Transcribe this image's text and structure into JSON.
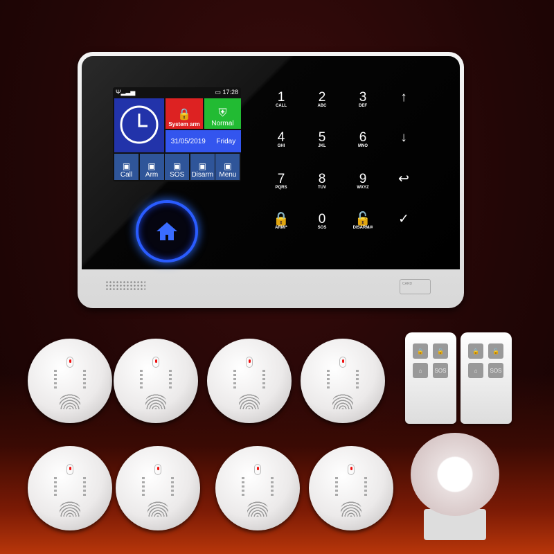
{
  "lcd": {
    "time": "17:28",
    "tiles": {
      "system_arm": "System arm",
      "normal": "Normal",
      "date": "31/05/2019",
      "day": "Friday"
    },
    "bottom": [
      {
        "label": "Call",
        "icon": "phone-icon"
      },
      {
        "label": "Arm",
        "icon": "lock-icon"
      },
      {
        "label": "SOS",
        "icon": "sos-icon"
      },
      {
        "label": "Disarm",
        "icon": "unlock-icon"
      },
      {
        "label": "Menu",
        "icon": "grid-icon"
      }
    ],
    "colors": {
      "clock_tile": "#2233aa",
      "system_arm": "#dd2222",
      "normal": "#22bb33",
      "date": "#3355ee",
      "bottom": "#2f5599"
    }
  },
  "keypad": [
    {
      "n": "1",
      "s": "CALL"
    },
    {
      "n": "2",
      "s": "ABC"
    },
    {
      "n": "3",
      "s": "DEF"
    },
    {
      "n": "↑",
      "s": ""
    },
    {
      "n": "4",
      "s": "GHI"
    },
    {
      "n": "5",
      "s": "JKL"
    },
    {
      "n": "6",
      "s": "MNO"
    },
    {
      "n": "↓",
      "s": ""
    },
    {
      "n": "7",
      "s": "PQRS"
    },
    {
      "n": "8",
      "s": "TUV"
    },
    {
      "n": "9",
      "s": "WXYZ"
    },
    {
      "n": "↩",
      "s": ""
    },
    {
      "n": "🔒",
      "s": "ARM/*"
    },
    {
      "n": "0",
      "s": "SOS"
    },
    {
      "n": "🔓",
      "s": "DISARM/#"
    },
    {
      "n": "✓",
      "s": ""
    }
  ],
  "card_label": "CARD",
  "remote_buttons": {
    "sos": "SOS"
  }
}
